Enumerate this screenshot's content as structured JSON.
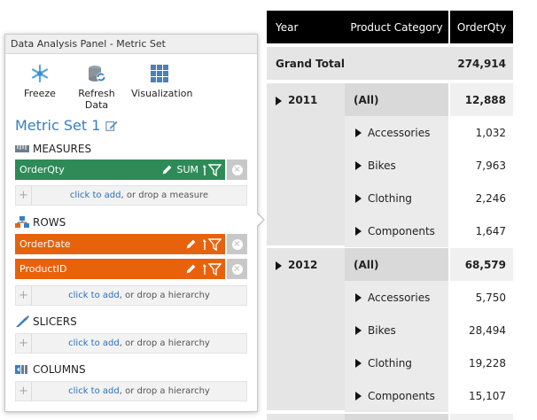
{
  "panel": {
    "title": "Data Analysis Panel - Metric Set",
    "toolbar": {
      "freeze": "Freeze",
      "refresh": "Refresh Data",
      "visualization": "Visualization"
    },
    "metric_set_title": "Metric Set 1",
    "sections": {
      "measures": "MEASURES",
      "rows": "ROWS",
      "slicers": "SLICERS",
      "columns": "COLUMNS"
    },
    "measures": [
      {
        "name": "OrderQty",
        "agg": "SUM"
      }
    ],
    "rows": [
      {
        "name": "OrderDate"
      },
      {
        "name": "ProductID"
      }
    ],
    "drop_measure": {
      "link": "click to add",
      "text": ", or drop a measure"
    },
    "drop_hierarchy": {
      "link": "click to add",
      "text": ", or drop a hierarchy"
    },
    "colors": {
      "measure": "#2e8b57",
      "row": "#e8620c",
      "link": "#3a7ec2"
    }
  },
  "table": {
    "headers": {
      "year": "Year",
      "category": "Product Category",
      "qty": "OrderQty"
    },
    "grand_total": {
      "label": "Grand Total",
      "value": "274,914"
    },
    "groups": [
      {
        "year": "2011",
        "rows": [
          {
            "category": "(All)",
            "value": "12,888"
          },
          {
            "category": "Accessories",
            "value": "1,032"
          },
          {
            "category": "Bikes",
            "value": "7,963"
          },
          {
            "category": "Clothing",
            "value": "2,246"
          },
          {
            "category": "Components",
            "value": "1,647"
          }
        ]
      },
      {
        "year": "2012",
        "rows": [
          {
            "category": "(All)",
            "value": "68,579"
          },
          {
            "category": "Accessories",
            "value": "5,750"
          },
          {
            "category": "Bikes",
            "value": "28,494"
          },
          {
            "category": "Clothing",
            "value": "19,228"
          },
          {
            "category": "Components",
            "value": "15,107"
          }
        ]
      }
    ]
  }
}
